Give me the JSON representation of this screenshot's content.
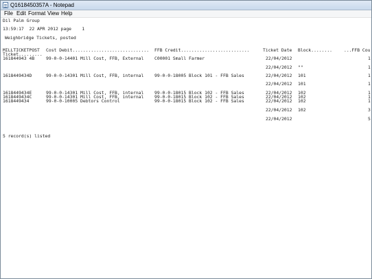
{
  "window": {
    "title": "Q1618450357A - Notepad"
  },
  "menu": [
    "File",
    "Edit",
    "Format",
    "View",
    "Help"
  ],
  "report": {
    "company": "Dil Palm Group",
    "timestamp": "13:59:17  22 APR 2012 page    1",
    "subtitle": "Weighbridge Tickets, posted",
    "headers": {
      "ticket": "MILLTICKETPOST",
      "ticket2": "Ticket.........",
      "cost_debit": "Cost Debit.............................",
      "ffb_credit": "FFB Credit..........................",
      "ticket_date": "Ticket Date",
      "block": "Block........",
      "ffb_count": "...FFB Cou"
    },
    "rows": [
      {
        "ticket": "161844943 4B",
        "debit": "99-0-0-14401 Mill Cost, FFB, External",
        "credit": "C00001 Small Farmer",
        "date": "22/04/2012",
        "block": "",
        "count": "1"
      },
      {
        "ticket": "",
        "debit": "",
        "credit": "",
        "date": "22/04/2012",
        "block": "\"\"",
        "count": "1"
      },
      {
        "ticket": "1618449434D",
        "debit": "99-0-0-14301 Mill Cost, FFB, internal",
        "credit": "99-0-0-18005 Block 101 - FFB Sales",
        "date": "22/04/2012",
        "block": "101",
        "count": "1"
      },
      {
        "ticket": "",
        "debit": "",
        "credit": "",
        "date": "22/04/2012",
        "block": "101",
        "count": "1"
      },
      {
        "ticket": "1618449434E",
        "debit": "99-0-0-14301 Mill Cost, FFB, internal",
        "credit": "99-0-0-18015 Block 102 - FFB Sales",
        "date": "22/04/2012",
        "block": "102",
        "count": "1"
      },
      {
        "ticket": "1618449434C",
        "debit": "99-0-0-14301 Mill Cost, FFB, internal",
        "credit": "99-0-0-18015 Block 102 - FFB Sales",
        "date": "22/04/2012",
        "block": "102",
        "count": "1"
      },
      {
        "ticket": "1618449434",
        "debit": "99-0-0-10005 Debtors Control",
        "credit": "99-0-0-18015 Block 102 - FFB Sales",
        "date": "22/04/2012",
        "block": "102",
        "count": "1"
      },
      {
        "ticket": "",
        "debit": "",
        "credit": "",
        "date": "22/04/2012",
        "block": "102",
        "count": "3"
      },
      {
        "ticket": "",
        "debit": "",
        "credit": "",
        "date": "22/04/2012",
        "block": "",
        "count": "5"
      }
    ],
    "footer": "5 record(s) listed"
  }
}
